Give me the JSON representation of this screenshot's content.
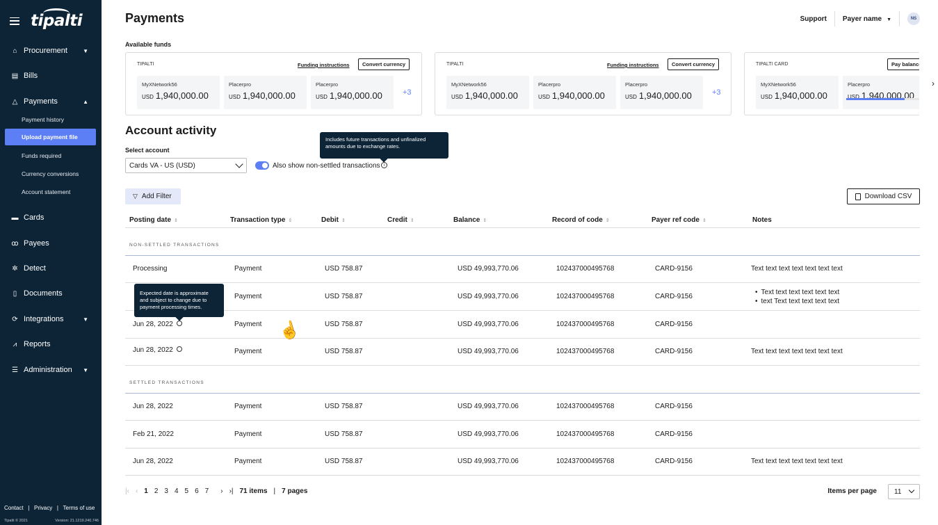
{
  "brand": {
    "logo": "tipalti"
  },
  "sidebar": {
    "items": [
      {
        "label": "Procurement"
      },
      {
        "label": "Bills"
      },
      {
        "label": "Payments"
      },
      {
        "label": "Cards"
      },
      {
        "label": "Payees"
      },
      {
        "label": "Detect"
      },
      {
        "label": "Documents"
      },
      {
        "label": "Integrations"
      },
      {
        "label": "Reports"
      },
      {
        "label": "Administration"
      }
    ],
    "payments_sub": [
      {
        "label": "Payment history"
      },
      {
        "label": "Upload payment file"
      },
      {
        "label": "Funds required"
      },
      {
        "label": "Currency conversions"
      },
      {
        "label": "Account statement"
      }
    ],
    "footer": {
      "contact": "Contact",
      "privacy": "Privacy",
      "terms": "Terms of use",
      "copyright": "Tipalti © 2021",
      "version": "Version: 21.1219.240.746"
    }
  },
  "header": {
    "title": "Payments",
    "support": "Support",
    "payer": "Payer name",
    "avatar": "NS"
  },
  "funds": {
    "label": "Available funds",
    "cards": [
      {
        "name": "TIPALTI",
        "link": "Funding instructions",
        "button": "Convert currency",
        "items": [
          {
            "name": "MyXNetwork56",
            "currency": "USD",
            "amount": "1,940,000.00"
          },
          {
            "name": "Placerpro",
            "currency": "USD",
            "amount": "1,940,000.00"
          },
          {
            "name": "Placerpro",
            "currency": "USD",
            "amount": "1,940,000.00"
          }
        ],
        "more": "+3"
      },
      {
        "name": "TIPALTI",
        "link": "Funding instructions",
        "button": "Convert currency",
        "items": [
          {
            "name": "MyXNetwork56",
            "currency": "USD",
            "amount": "1,940,000.00"
          },
          {
            "name": "Placerpro",
            "currency": "USD",
            "amount": "1,940,000.00"
          },
          {
            "name": "Placerpro",
            "currency": "USD",
            "amount": "1,940,000.00"
          }
        ],
        "more": "+3"
      },
      {
        "name": "TIPALTI CARD",
        "button": "Pay balance",
        "items": [
          {
            "name": "MyXNetwork56",
            "currency": "USD",
            "amount": "1,940,000.00"
          },
          {
            "name": "Placerpro",
            "currency": "USD",
            "amount": "1,940,000.00",
            "progress": 0.75
          }
        ]
      }
    ]
  },
  "activity": {
    "title": "Account activity",
    "select_label": "Select account",
    "selected_account": "Cards VA - US (USD)",
    "toggle_label": "Also show non-settled transactions",
    "toggle_on": true,
    "tooltip": "Includes future transactions and unfinalized amounts due to exchange rates.",
    "date_tooltip": "Expected date is approximate and subject to change due to payment processing times.",
    "add_filter": "Add Filter",
    "download_csv": "Download CSV"
  },
  "table": {
    "columns": [
      "Posting date",
      "Transaction type",
      "Debit",
      "Credit",
      "Balance",
      "Record of code",
      "Payer ref code",
      "Notes"
    ],
    "non_settled_label": "NON-SETTLED TRANSACTIONS",
    "settled_label": "SETTLED TRANSACTIONS",
    "non_settled": [
      {
        "date": "Processing",
        "type": "Payment",
        "debit": "USD 758.87",
        "credit": "",
        "balance": "USD 49,993,770.06",
        "record": "102437000495768",
        "payer_ref": "CARD-9156",
        "notes": "Text text text text text text text"
      },
      {
        "date": "",
        "type": "Payment",
        "debit": "USD 758.87",
        "credit": "",
        "balance": "USD 49,993,770.06",
        "record": "102437000495768",
        "payer_ref": "CARD-9156",
        "notes_list": [
          "Text text text text text text",
          "text Text text text text text"
        ]
      },
      {
        "date": "Jun 28, 2022",
        "type": "Payment",
        "debit": "USD 758.87",
        "credit": "",
        "balance": "USD 49,993,770.06",
        "record": "102437000495768",
        "payer_ref": "CARD-9156",
        "notes": ""
      },
      {
        "date": "Jun 28, 2022",
        "type": "Payment",
        "debit": "USD 758.87",
        "credit": "",
        "balance": "USD 49,993,770.06",
        "record": "102437000495768",
        "payer_ref": "CARD-9156",
        "notes": "Text text text text text text text"
      }
    ],
    "settled": [
      {
        "date": "Jun 28, 2022",
        "type": "Payment",
        "debit": "USD 758.87",
        "credit": "",
        "balance": "USD 49,993,770.06",
        "record": "102437000495768",
        "payer_ref": "CARD-9156",
        "notes": ""
      },
      {
        "date": "Feb 21, 2022",
        "type": "Payment",
        "debit": "USD 758.87",
        "credit": "",
        "balance": "USD 49,993,770.06",
        "record": "102437000495768",
        "payer_ref": "CARD-9156",
        "notes": ""
      },
      {
        "date": "Jun 28, 2022",
        "type": "Payment",
        "debit": "USD 758.87",
        "credit": "",
        "balance": "USD 49,993,770.06",
        "record": "102437000495768",
        "payer_ref": "CARD-9156",
        "notes": "Text text text text text text text"
      }
    ]
  },
  "pagination": {
    "pages": [
      "1",
      "2",
      "3",
      "4",
      "5",
      "6",
      "7"
    ],
    "current": "1",
    "items_count": "71 items",
    "pages_count": "7 pages",
    "items_per_page_label": "Items per page",
    "items_per_page": "11"
  },
  "colors": {
    "sidebar_bg": "#0d2437",
    "accent": "#5d7ff6",
    "filter_bg": "#e3e9f8"
  }
}
